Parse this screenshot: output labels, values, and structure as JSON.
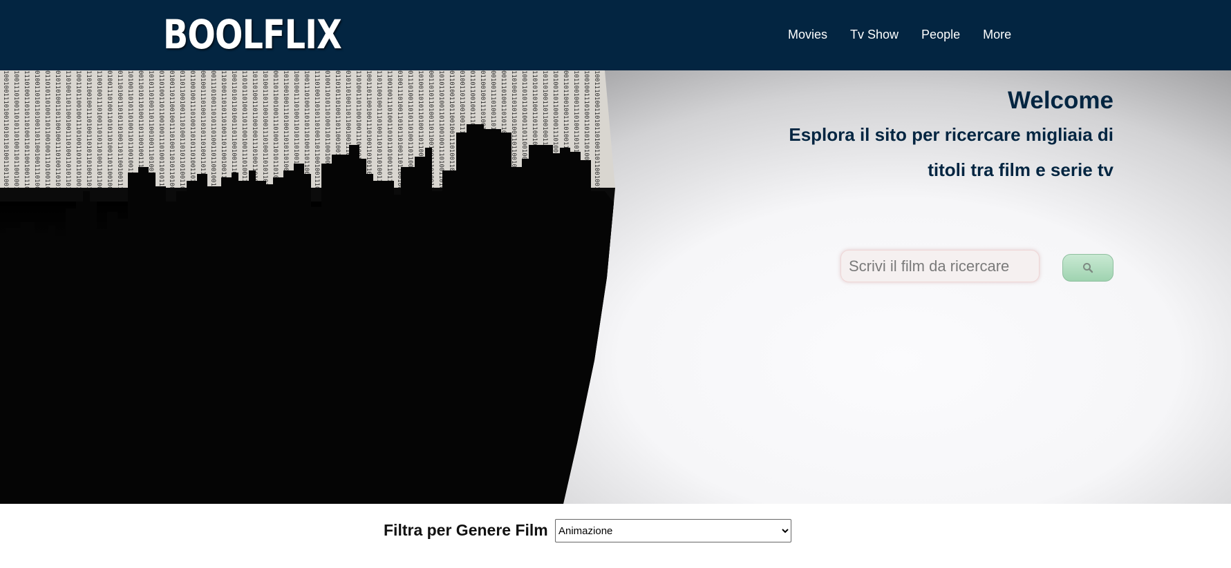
{
  "header": {
    "logo": "BOOLFLIX",
    "nav": [
      "Movies",
      "Tv Show",
      "People",
      "More"
    ],
    "background_color": "#032541"
  },
  "hero": {
    "title": "Welcome",
    "subtitle": "Esplora il sito per ricercare migliaia di titoli tra film e serie tv",
    "search": {
      "placeholder": "Scrivi il film da ricercare",
      "value": "",
      "button_icon": "search-icon"
    },
    "image_icon": "hooded-figure-binary-city-image",
    "binary_text": "1001001110100110101101001101"
  },
  "filter": {
    "label": "Filtra per Genere Film",
    "selected": "Animazione"
  },
  "colors": {
    "brand_dark": "#032541",
    "search_button": "#a9dbb8"
  }
}
